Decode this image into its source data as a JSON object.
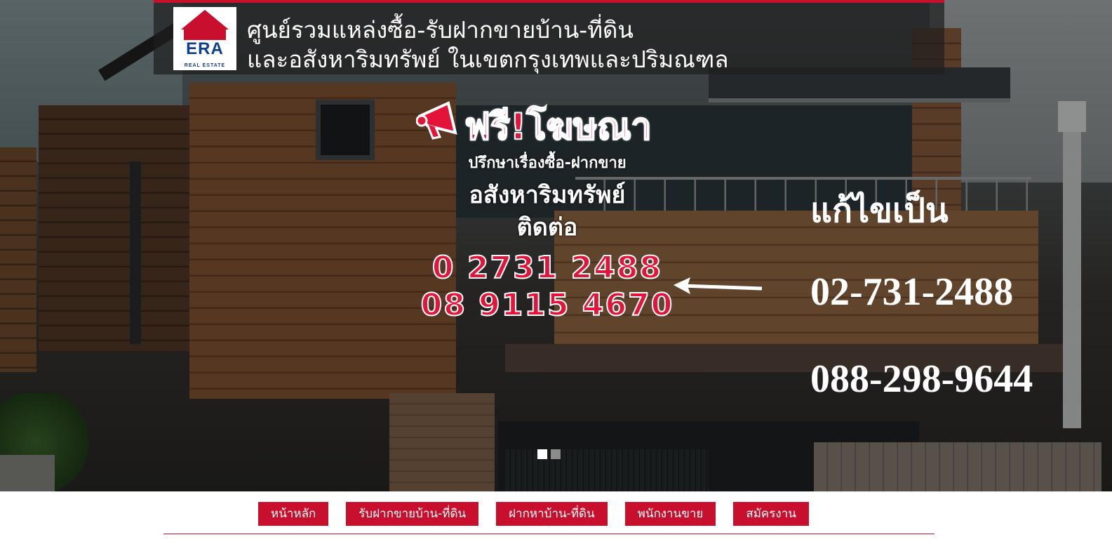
{
  "banner": {
    "logo_text": "ERA",
    "logo_subtext": "REAL ESTATE",
    "line1": "ศูนย์รวมแหล่งซื้อ-รับฝากขายบ้าน-ที่ดิน",
    "line2": "และอสังหาริมทรัพย์ ในเขตกรุงเทพและปริมณฑล"
  },
  "promo": {
    "title": "ฟรี!โฆษณา",
    "subtitle": "ปรึกษาเรื่องซื้อ-ฝากขาย",
    "asset": "อสังหาริมทรัพย์",
    "contact": "ติดต่อ",
    "phone1": "0 2731 2488",
    "phone2": "08 9115 4670"
  },
  "edit": {
    "label": "แก้ไขเป็น",
    "phone1": "02-731-2488",
    "phone2": "088-298-9644"
  },
  "slider": {
    "total": 2,
    "active_index": 0
  },
  "nav": {
    "items": [
      {
        "label": "หน้าหลัก"
      },
      {
        "label": "รับฝากขายบ้าน-ที่ดิน"
      },
      {
        "label": "ฝากหาบ้าน-ที่ดิน"
      },
      {
        "label": "พนักงานขาย"
      },
      {
        "label": "สมัครงาน"
      }
    ]
  },
  "colors": {
    "brand_red": "#c8102e",
    "promo_red": "#e4133a",
    "era_blue": "#0d3f8f"
  },
  "icons": {
    "megaphone": "megaphone-icon",
    "arrow": "arrow-left-icon"
  }
}
